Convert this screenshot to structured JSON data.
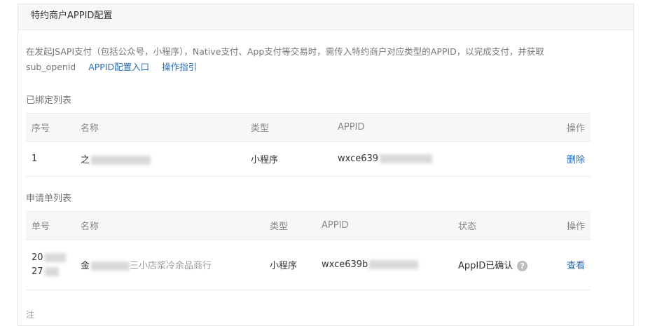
{
  "panel": {
    "title": "特约商户APPID配置"
  },
  "description": {
    "text": "在发起JSAPI支付（包括公众号，小程序），Native支付、App支付等交易时，需传入特约商户对应类型的APPID，以完成支付，并获取sub_openid",
    "link_config": "APPID配置入口",
    "link_guide": "操作指引"
  },
  "bound": {
    "title": "已绑定列表",
    "headers": {
      "index": "序号",
      "name": "名称",
      "type": "类型",
      "appid": "APPID",
      "action": "操作"
    },
    "rows": [
      {
        "index": "1",
        "name": "之",
        "type": "小程序",
        "appid": "wxce639",
        "action": "删除"
      }
    ]
  },
  "applications": {
    "title": "申请单列表",
    "headers": {
      "number": "单号",
      "name": "名称",
      "type": "类型",
      "appid": "APPID",
      "status": "状态",
      "action": "操作"
    },
    "rows": [
      {
        "number_line1": "20",
        "number_line2": "27",
        "name_prefix": "金",
        "name_suffix": "三小店浆冷余品商行",
        "type": "小程序",
        "appid": "wxce639b",
        "status": "AppID已确认",
        "action": "查看"
      }
    ]
  },
  "footer_note": "注",
  "colors": {
    "link": "#2d6db5",
    "header_bg": "#f7f7f7",
    "muted": "#777777"
  }
}
